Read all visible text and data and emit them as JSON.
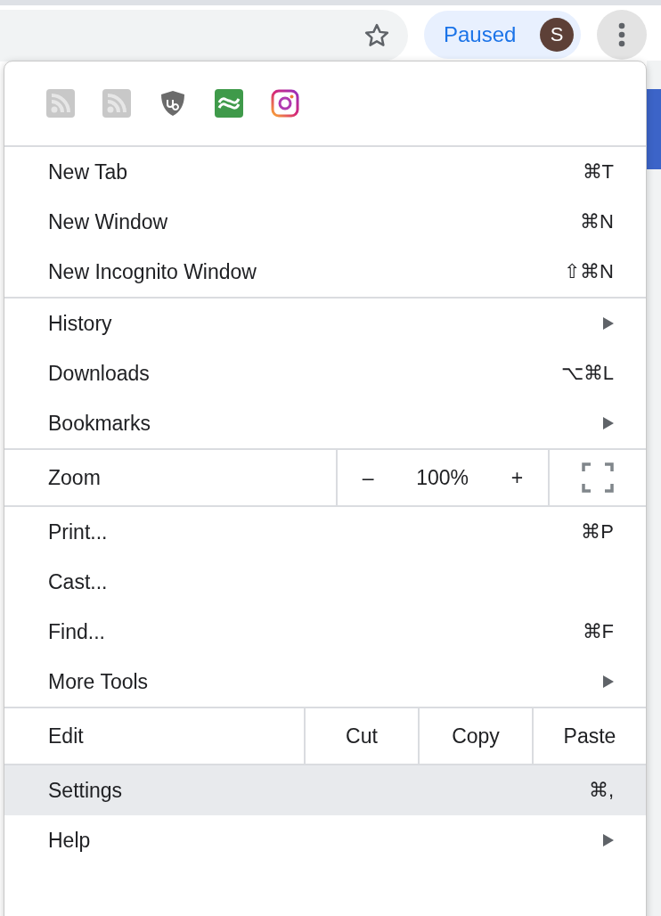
{
  "toolbar": {
    "profile_status": "Paused",
    "avatar_initial": "S"
  },
  "menu": {
    "sections": [
      [
        {
          "kind": "item",
          "label": "New Tab",
          "shortcut": "⌘T",
          "submenu": false,
          "selected": false
        },
        {
          "kind": "item",
          "label": "New Window",
          "shortcut": "⌘N",
          "submenu": false,
          "selected": false
        },
        {
          "kind": "item",
          "label": "New Incognito Window",
          "shortcut": "⇧⌘N",
          "submenu": false,
          "selected": false
        }
      ],
      [
        {
          "kind": "item",
          "label": "History",
          "submenu": true,
          "selected": false
        },
        {
          "kind": "item",
          "label": "Downloads",
          "shortcut": "⌥⌘L",
          "submenu": false,
          "selected": false
        },
        {
          "kind": "item",
          "label": "Bookmarks",
          "submenu": true,
          "selected": false
        }
      ],
      [
        {
          "kind": "zoom",
          "label": "Zoom",
          "minus": "–",
          "value": "100%",
          "plus": "+"
        }
      ],
      [
        {
          "kind": "item",
          "label": "Print...",
          "shortcut": "⌘P",
          "submenu": false,
          "selected": false
        },
        {
          "kind": "item",
          "label": "Cast...",
          "submenu": false,
          "selected": false
        },
        {
          "kind": "item",
          "label": "Find...",
          "shortcut": "⌘F",
          "submenu": false,
          "selected": false
        },
        {
          "kind": "item",
          "label": "More Tools",
          "submenu": true,
          "selected": false
        }
      ],
      [
        {
          "kind": "edit",
          "label": "Edit",
          "actions": [
            "Cut",
            "Copy",
            "Paste"
          ]
        }
      ],
      [
        {
          "kind": "item",
          "label": "Settings",
          "shortcut": "⌘,",
          "submenu": false,
          "selected": true
        },
        {
          "kind": "item",
          "label": "Help",
          "submenu": true,
          "selected": false
        }
      ]
    ]
  }
}
